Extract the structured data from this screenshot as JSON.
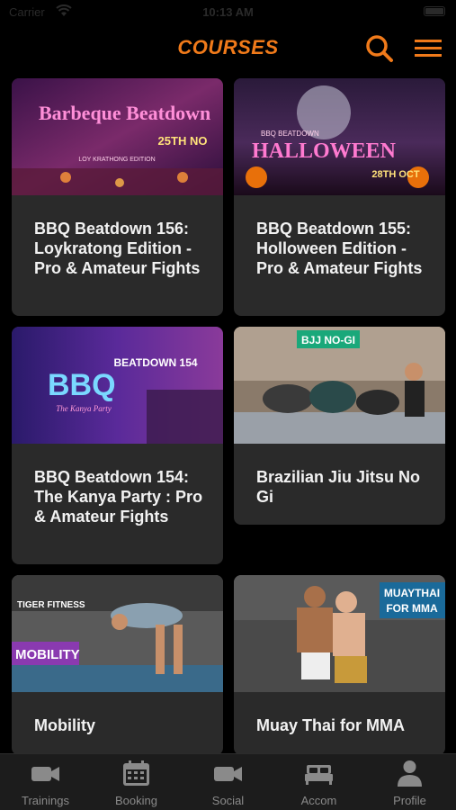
{
  "status_bar": {
    "carrier": "Carrier",
    "time": "10:13 AM"
  },
  "header": {
    "title": "COURSES"
  },
  "courses": [
    {
      "title": "BBQ Beatdown 156: Loykratong Edition - Pro & Amateur Fights",
      "image_text": "Barbeque Beatdown",
      "image_badge": "25TH NO",
      "image_subtitle": "LOY KRATHONG EDITION"
    },
    {
      "title": "BBQ Beatdown 155: Holloween Edition - Pro & Amateur Fights",
      "image_text": "HALLOWEEN",
      "image_badge": "28TH OCT",
      "image_subtitle": "BBQ BEATDOWN"
    },
    {
      "title": "BBQ Beatdown 154: The Kanya Party : Pro & Amateur Fights",
      "image_text": "BBQ",
      "image_badge": "BEATDOWN 154",
      "image_subtitle": "The Kanya Party"
    },
    {
      "title": "Brazilian Jiu Jitsu No Gi",
      "image_text": "BJJ NO-GI"
    },
    {
      "title": "Mobility",
      "image_text": "MOBILITY",
      "image_subtitle": "TIGER FITNESS"
    },
    {
      "title": "Muay Thai for MMA",
      "image_text": "MUAYTHAI",
      "image_subtitle": "FOR MMA"
    }
  ],
  "tabs": [
    {
      "label": "Trainings",
      "icon": "video-camera-icon"
    },
    {
      "label": "Booking",
      "icon": "calendar-icon"
    },
    {
      "label": "Social",
      "icon": "video-camera-icon"
    },
    {
      "label": "Accom",
      "icon": "bed-icon"
    },
    {
      "label": "Profile",
      "icon": "person-icon"
    }
  ],
  "colors": {
    "accent": "#f07a1a",
    "card": "#2a2a2a",
    "tabbar": "#1c1c1c",
    "tab_inactive": "#8a8a8a"
  }
}
